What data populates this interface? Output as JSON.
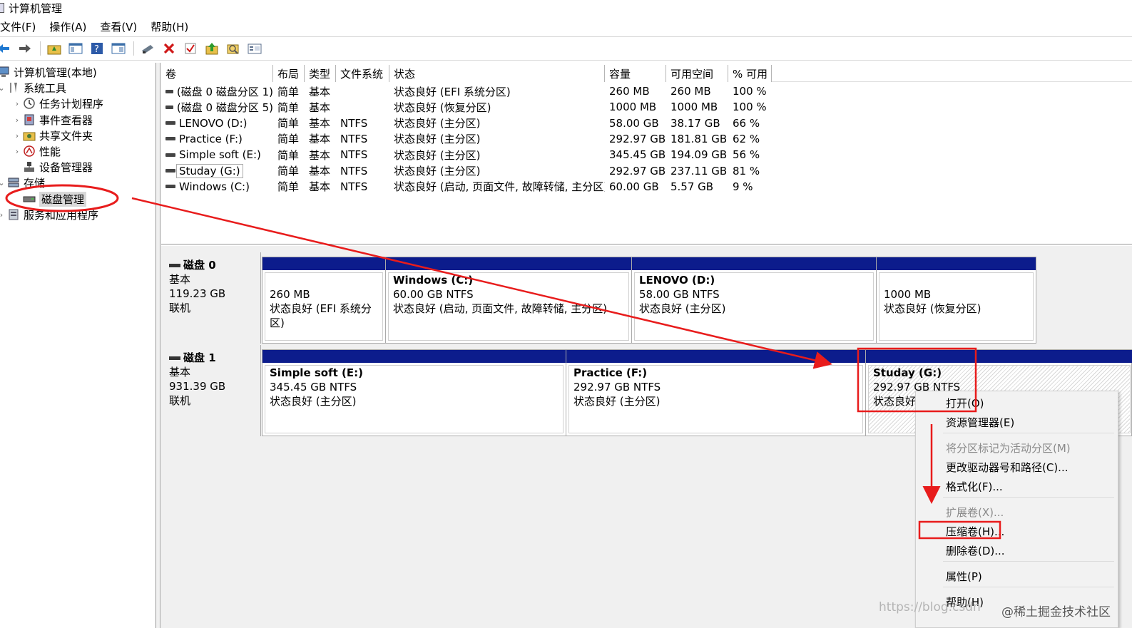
{
  "window": {
    "title": "计算机管理"
  },
  "menu": [
    "文件(F)",
    "操作(A)",
    "查看(V)",
    "帮助(H)"
  ],
  "toolbar": {
    "icons": [
      "back-arrow-icon",
      "forward-arrow-icon",
      "up-folder-icon",
      "show-hide-tree-icon",
      "help-icon",
      "properties-pane-icon",
      "connect-drive-icon",
      "delete-icon",
      "check-icon",
      "import-icon",
      "search-icon",
      "properties-icon"
    ]
  },
  "tree": {
    "root": "计算机管理(本地)",
    "system_tools": "系统工具",
    "task_scheduler": "任务计划程序",
    "event_viewer": "事件查看器",
    "shared_folders": "共享文件夹",
    "performance": "性能",
    "device_manager": "设备管理器",
    "storage": "存储",
    "disk_management": "磁盘管理",
    "services_apps": "服务和应用程序"
  },
  "volume_list": {
    "columns": [
      "卷",
      "布局",
      "类型",
      "文件系统",
      "状态",
      "容量",
      "可用空间",
      "% 可用"
    ],
    "rows": [
      {
        "volume": "(磁盘 0 磁盘分区 1)",
        "layout": "简单",
        "type": "基本",
        "fs": "",
        "status": "状态良好 (EFI 系统分区)",
        "capacity": "260 MB",
        "free": "260 MB",
        "pct": "100 %"
      },
      {
        "volume": "(磁盘 0 磁盘分区 5)",
        "layout": "简单",
        "type": "基本",
        "fs": "",
        "status": "状态良好 (恢复分区)",
        "capacity": "1000 MB",
        "free": "1000 MB",
        "pct": "100 %"
      },
      {
        "volume": "LENOVO (D:)",
        "layout": "简单",
        "type": "基本",
        "fs": "NTFS",
        "status": "状态良好 (主分区)",
        "capacity": "58.00 GB",
        "free": "38.17 GB",
        "pct": "66 %"
      },
      {
        "volume": "Practice (F:)",
        "layout": "简单",
        "type": "基本",
        "fs": "NTFS",
        "status": "状态良好 (主分区)",
        "capacity": "292.97 GB",
        "free": "181.81 GB",
        "pct": "62 %"
      },
      {
        "volume": "Simple soft (E:)",
        "layout": "简单",
        "type": "基本",
        "fs": "NTFS",
        "status": "状态良好 (主分区)",
        "capacity": "345.45 GB",
        "free": "194.09 GB",
        "pct": "56 %"
      },
      {
        "volume": "Studay (G:)",
        "layout": "简单",
        "type": "基本",
        "fs": "NTFS",
        "status": "状态良好 (主分区)",
        "capacity": "292.97 GB",
        "free": "237.11 GB",
        "pct": "81 %"
      },
      {
        "volume": "Windows (C:)",
        "layout": "简单",
        "type": "基本",
        "fs": "NTFS",
        "status": "状态良好 (启动, 页面文件, 故障转储, 主分区)",
        "capacity": "60.00 GB",
        "free": "5.57 GB",
        "pct": "9 %"
      }
    ]
  },
  "disk0": {
    "name": "磁盘 0",
    "kind": "基本",
    "size": "119.23 GB",
    "state": "联机",
    "parts": [
      {
        "name": "",
        "size": "260 MB",
        "status": "状态良好 (EFI 系统分区)"
      },
      {
        "name": "Windows  (C:)",
        "size": "60.00 GB NTFS",
        "status": "状态良好 (启动, 页面文件, 故障转储, 主分区)"
      },
      {
        "name": "LENOVO  (D:)",
        "size": "58.00 GB NTFS",
        "status": "状态良好 (主分区)"
      },
      {
        "name": "",
        "size": "1000 MB",
        "status": "状态良好 (恢复分区)"
      }
    ]
  },
  "disk1": {
    "name": "磁盘 1",
    "kind": "基本",
    "size": "931.39 GB",
    "state": "联机",
    "parts": [
      {
        "name": "Simple soft  (E:)",
        "size": "345.45 GB NTFS",
        "status": "状态良好 (主分区)"
      },
      {
        "name": "Practice  (F:)",
        "size": "292.97 GB NTFS",
        "status": "状态良好 (主分区)"
      },
      {
        "name": "Studay  (G:)",
        "size": "292.97 GB NTFS",
        "status": "状态良好"
      }
    ]
  },
  "context_menu": {
    "open": "打开(O)",
    "explorer": "资源管理器(E)",
    "mark_active": "将分区标记为活动分区(M)",
    "change_letter": "更改驱动器号和路径(C)...",
    "format": "格式化(F)...",
    "extend": "扩展卷(X)...",
    "shrink": "压缩卷(H)...",
    "delete": "删除卷(D)...",
    "properties": "属性(P)",
    "help": "帮助(H)"
  },
  "annotation_color": "#e81c1c",
  "selection_band_color": "#0c1c8c",
  "watermark": {
    "url": "https://blog.csdn",
    "community": "@稀土掘金技术社区"
  }
}
